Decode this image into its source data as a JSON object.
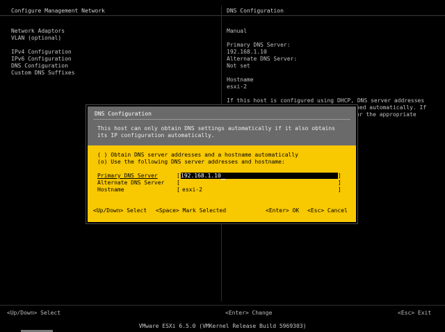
{
  "left_panel": {
    "title": "Configure Management Network",
    "menu": [
      "Network Adaptors",
      "VLAN (optional)",
      "",
      "IPv4 Configuration",
      "IPv6 Configuration",
      "DNS Configuration",
      "Custom DNS Suffixes"
    ]
  },
  "right_panel": {
    "title": "DNS Configuration",
    "mode": "Manual",
    "primary_label": "Primary DNS Server:",
    "primary_value": "192.168.1.10",
    "alternate_label": "Alternate DNS Server:",
    "alternate_value": "Not set",
    "hostname_label": "Hostname",
    "hostname_value": "esxi-2",
    "info_line1": "If this host is configured using DHCP, DNS server addresses",
    "info_line2": "ned automatically. If",
    "info_line3": "or the appropriate"
  },
  "dialog": {
    "title": "DNS Configuration",
    "desc_line1": "This host can only obtain DNS settings automatically if it also obtains",
    "desc_line2": "its IP configuration automatically.",
    "option_auto": "( ) Obtain DNS server addresses and a hostname automatically",
    "option_manual": "(o) Use the following DNS server addresses and hostname:",
    "fields": [
      {
        "label": "Primary DNS Server",
        "value": "192.168.1.10"
      },
      {
        "label": "Alternate DNS Server",
        "value": ""
      },
      {
        "label": "Hostname",
        "value": "esxi-2"
      }
    ],
    "bracket_open": "[",
    "bracket_close": "]",
    "keys": {
      "updown_key": "<Up/Down>",
      "updown_action": "Select",
      "space_key": "<Space>",
      "space_action": "Mark Selected",
      "enter_key": "<Enter>",
      "enter_action": "OK",
      "esc_key": "<Esc>",
      "esc_action": "Cancel"
    }
  },
  "bottom_bar": {
    "left": "<Up/Down> Select",
    "center": "<Enter> Change",
    "right": "<Esc> Exit"
  },
  "footer": "VMware ESXi 6.5.0 (VMKernel Release Build 5969303)"
}
